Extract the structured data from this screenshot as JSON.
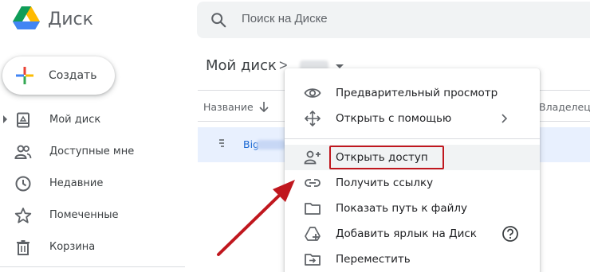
{
  "app": {
    "title": "Диск"
  },
  "search": {
    "placeholder": "Поиск на Диске"
  },
  "create_button": {
    "label": "Создать"
  },
  "sidebar": {
    "items": [
      {
        "label": "Мой диск",
        "icon": "my-drive-icon"
      },
      {
        "label": "Доступные мне",
        "icon": "shared-people-icon"
      },
      {
        "label": "Недавние",
        "icon": "clock-icon"
      },
      {
        "label": "Помеченные",
        "icon": "star-icon"
      },
      {
        "label": "Корзина",
        "icon": "trash-icon"
      }
    ]
  },
  "breadcrumb": {
    "root": "Мой диск",
    "separator": ">"
  },
  "table": {
    "columns": {
      "name": "Название",
      "owner": "Владелец"
    },
    "rows": [
      {
        "name": "Big"
      }
    ]
  },
  "context_menu": {
    "items": [
      {
        "label": "Предварительный просмотр",
        "icon": "eye-icon"
      },
      {
        "label": "Открыть с помощью",
        "icon": "move-arrows-icon",
        "submenu": true
      },
      {
        "label": "Открыть доступ",
        "icon": "add-person-icon",
        "highlighted": true
      },
      {
        "label": "Получить ссылку",
        "icon": "link-icon"
      },
      {
        "label": "Показать путь к файлу",
        "icon": "folder-icon"
      },
      {
        "label": "Добавить ярлык на Диск",
        "icon": "add-shortcut-icon",
        "help": true
      },
      {
        "label": "Переместить",
        "icon": "move-to-folder-icon"
      }
    ]
  },
  "colors": {
    "accent": "#1967d2",
    "selected_row": "#e8f0fe",
    "annotation_red": "#c0171e"
  }
}
